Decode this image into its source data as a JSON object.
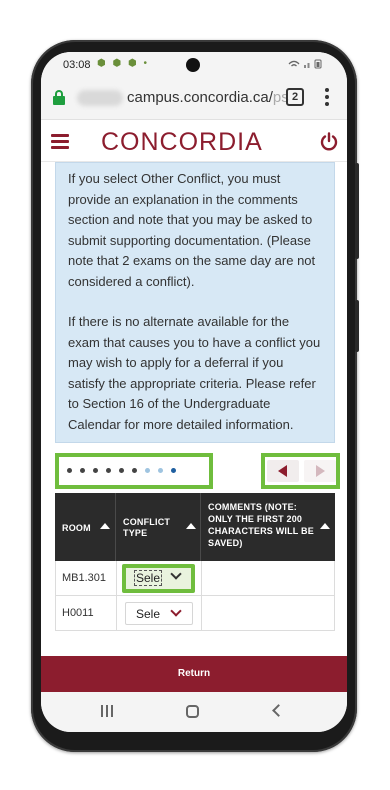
{
  "status_bar": {
    "time": "03:08",
    "notification_icons": "⬢ ⬢ ⬢ •",
    "tray_icons": "📶 ▮▮ ▮"
  },
  "browser": {
    "url_domain": "campus.concordia.ca/",
    "url_tail": "ps",
    "tab_count": "2"
  },
  "header": {
    "brand": "CONCORDIA"
  },
  "info": {
    "paragraph_1": "If you select Other Conflict, you must provide an explanation in the comments section and note that you may be asked to submit supporting documentation. (Please note that 2 exams on the same day are not considered a conflict).",
    "paragraph_2": "If there is no alternate available for the exam that causes you to have a conflict you may wish to apply for a deferral if you satisfy the appropriate criteria. Please refer to Section 16 of the Undergraduate Calendar for more detailed information."
  },
  "table": {
    "columns": [
      "ROOM",
      "CONFLICT TYPE",
      "COMMENTS (NOTE: ONLY THE FIRST 200 CHARACTERS WILL BE SAVED)"
    ],
    "rows": [
      {
        "room": "MB1.301",
        "conflict_type": "Sele",
        "comments": ""
      },
      {
        "room": "H0011",
        "conflict_type": "Sele",
        "comments": ""
      }
    ]
  },
  "footer": {
    "return_label": "Return"
  },
  "colors": {
    "brand": "#8c1d2e",
    "info_bg": "#d7e8f5",
    "highlight": "#6fbd3d",
    "table_header": "#2b2b2b"
  }
}
